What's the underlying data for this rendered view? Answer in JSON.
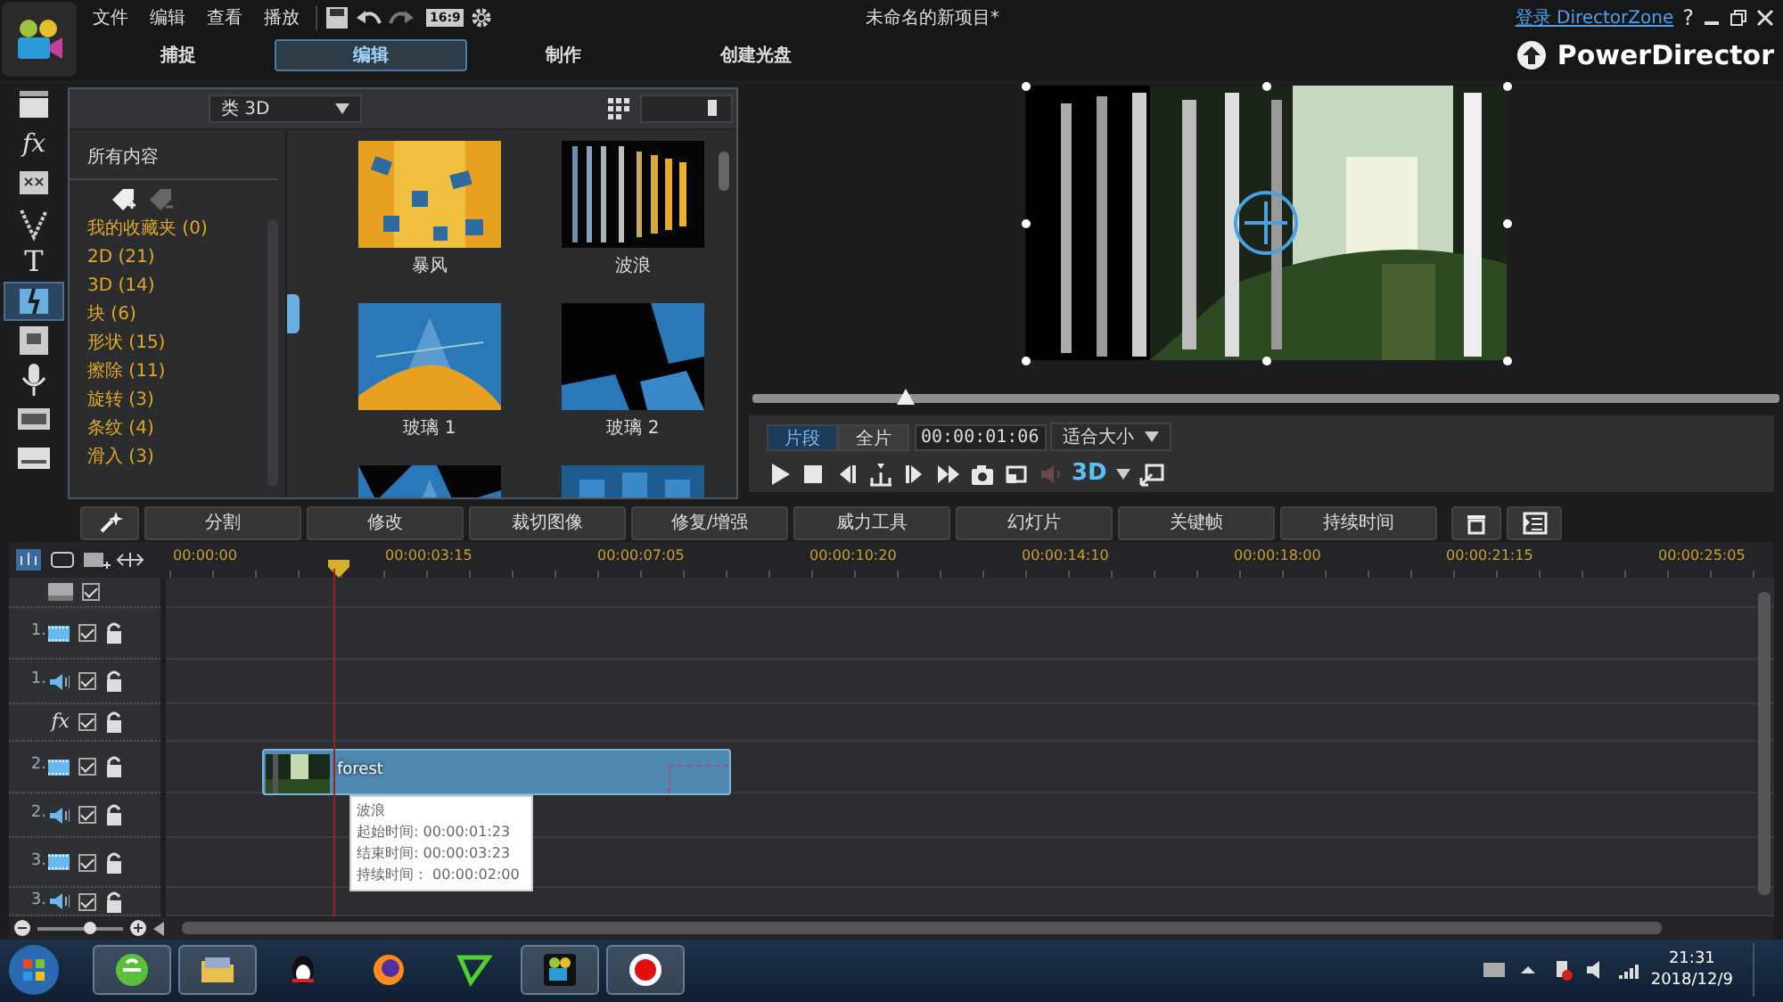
{
  "window": {
    "title": "未命名的新项目*",
    "menu": [
      "文件",
      "编辑",
      "查看",
      "播放"
    ],
    "aspect": "16:9",
    "login_link": "登录 DirectorZone",
    "help": "?"
  },
  "tabs": [
    {
      "label": "捕捉",
      "selected": false
    },
    {
      "label": "编辑",
      "selected": true
    },
    {
      "label": "制作",
      "selected": false
    },
    {
      "label": "创建光盘",
      "selected": false
    }
  ],
  "brand": "PowerDirector",
  "rail": [
    {
      "kind": "media",
      "selected": false
    },
    {
      "kind": "fx",
      "label": "fx",
      "selected": false
    },
    {
      "kind": "pip",
      "selected": false
    },
    {
      "kind": "particle",
      "selected": false
    },
    {
      "kind": "title",
      "label": "T",
      "selected": false
    },
    {
      "kind": "transition",
      "selected": true
    },
    {
      "kind": "audio-mix",
      "selected": false
    },
    {
      "kind": "voice",
      "selected": false
    },
    {
      "kind": "chapter",
      "selected": false
    },
    {
      "kind": "subtitle",
      "selected": false
    }
  ],
  "library": {
    "filter": "类 3D",
    "size_slider": {
      "level": 0.75
    },
    "section": "所有内容",
    "categories": [
      {
        "name": "我的收藏夹",
        "count": "(0)"
      },
      {
        "name": "2D",
        "count": "(21)"
      },
      {
        "name": "3D",
        "count": "(14)"
      },
      {
        "name": "块",
        "count": "(6)"
      },
      {
        "name": "形状",
        "count": "(15)"
      },
      {
        "name": "擦除",
        "count": "(11)"
      },
      {
        "name": "旋转",
        "count": "(3)"
      },
      {
        "name": "条纹",
        "count": "(4)"
      },
      {
        "name": "滑入",
        "count": "(3)"
      }
    ],
    "thumbnails": [
      {
        "kind": "effect",
        "label": "暴风"
      },
      {
        "kind": "effect",
        "label": "波浪"
      },
      {
        "kind": "effect",
        "label": "玻璃 1"
      },
      {
        "kind": "effect",
        "label": "玻璃 2"
      },
      {
        "kind": "partial"
      },
      {
        "kind": "partial"
      }
    ]
  },
  "preview": {
    "scrubber": {
      "level": 0.15
    },
    "modes": [
      {
        "label": "片段",
        "selected": true
      },
      {
        "label": "全片",
        "selected": false
      }
    ],
    "timecode": "00:00:01:06",
    "fit": "适合大小",
    "volume_disabled": true,
    "stereo": "3D"
  },
  "toolbar": [
    "分割",
    "修改",
    "裁切图像",
    "修复/增强",
    "威力工具",
    "幻灯片",
    "关键帧",
    "持续时间"
  ],
  "timeline": {
    "ruler": [
      "00:00:00",
      "00:00:03:15",
      "00:00:07:05",
      "00:00:10:20",
      "00:00:14:10",
      "00:00:18:00",
      "00:00:21:15",
      "00:00:25:05"
    ],
    "tracks": [
      {
        "kind": "overlay",
        "checked": true
      },
      {
        "kind": "video",
        "number": "1.",
        "checked": true
      },
      {
        "kind": "audio",
        "number": "1.",
        "checked": true
      },
      {
        "kind": "fx",
        "number": "fx",
        "checked": true
      },
      {
        "kind": "video",
        "number": "2.",
        "checked": true
      },
      {
        "kind": "audio",
        "number": "2.",
        "checked": true
      },
      {
        "kind": "video",
        "number": "3.",
        "checked": true
      },
      {
        "kind": "audio",
        "number": "3.",
        "checked": true
      }
    ],
    "clip": {
      "name": "forest"
    },
    "tooltip": [
      "波浪",
      "起始时间: 00:00:01:23",
      "结束时间: 00:00:03:23",
      "持续时间： 00:00:02:00"
    ],
    "zoom_slider": {
      "level": 0.6
    }
  },
  "taskbar": {
    "apps": [
      {
        "kind": "ie",
        "running": true
      },
      {
        "kind": "folder",
        "running": true
      },
      {
        "kind": "qq",
        "running": false
      },
      {
        "kind": "firefox",
        "running": false
      },
      {
        "kind": "green",
        "running": false
      },
      {
        "kind": "powerdirector",
        "running": true
      },
      {
        "kind": "record",
        "running": true
      }
    ],
    "time": "21:31",
    "date": "2018/12/9"
  }
}
